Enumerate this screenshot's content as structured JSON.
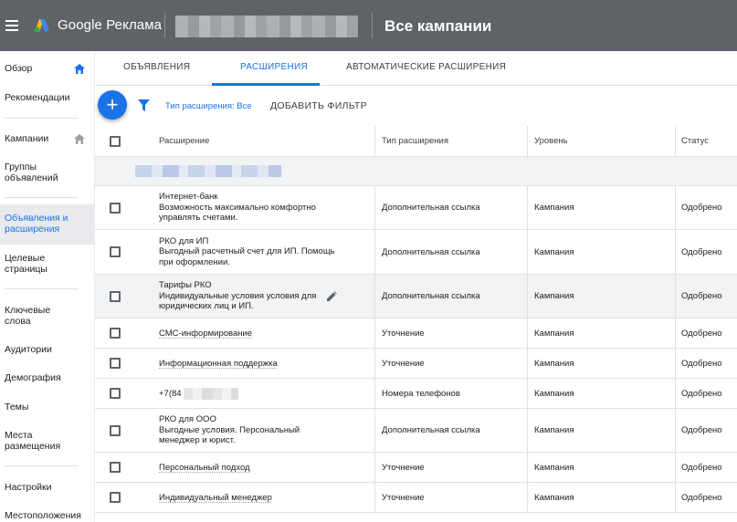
{
  "header": {
    "brand": "Google Реклама",
    "title": "Все кампании"
  },
  "sidebar": {
    "items": [
      {
        "label": "Обзор"
      },
      {
        "label": "Рекомендации"
      },
      {
        "label": "Кампании"
      },
      {
        "label": "Группы объявлений"
      },
      {
        "label": "Объявления и расширения"
      },
      {
        "label": "Целевые страницы"
      },
      {
        "label": "Ключевые слова"
      },
      {
        "label": "Аудитории"
      },
      {
        "label": "Демография"
      },
      {
        "label": "Темы"
      },
      {
        "label": "Места размещения"
      },
      {
        "label": "Настройки"
      },
      {
        "label": "Местоположения"
      }
    ]
  },
  "tabs": [
    {
      "label": "ОБЪЯВЛЕНИЯ"
    },
    {
      "label": "РАСШИРЕНИЯ"
    },
    {
      "label": "АВТОМАТИЧЕСКИЕ РАСШИРЕНИЯ"
    }
  ],
  "toolbar": {
    "fab": "+",
    "filter_label": "Тип расширения: Все",
    "add_filter": "ДОБАВИТЬ ФИЛЬТР"
  },
  "table": {
    "columns": [
      "Расширение",
      "Тип расширения",
      "Уровень",
      "Статус"
    ],
    "rows": [
      {
        "title": "Интернет-банк",
        "desc": "Возможность максимально комфортно управлять счетами.",
        "type": "Дополнительная ссылка",
        "level": "Кампания",
        "status": "Одобрено"
      },
      {
        "title": "РКО для ИП",
        "desc": "Выгодный расчетный счет для ИП. Помощь при оформлении.",
        "type": "Дополнительная ссылка",
        "level": "Кампания",
        "status": "Одобрено"
      },
      {
        "title": "Тарифы РКО",
        "desc": "Индивидуальные условия условия для юридических лиц и ИП.",
        "type": "Дополнительная ссылка",
        "level": "Кампания",
        "status": "Одобрено"
      },
      {
        "title": "СМС-информирование",
        "desc": "",
        "type": "Уточнение",
        "level": "Кампания",
        "status": "Одобрено"
      },
      {
        "title": "Информационная поддержка",
        "desc": "",
        "type": "Уточнение",
        "level": "Кампания",
        "status": "Одобрено"
      },
      {
        "title": "+7(84",
        "desc": "",
        "type": "Номера телефонов",
        "level": "Кампания",
        "status": "Одобрено"
      },
      {
        "title": "РКО для ООО",
        "desc": "Выгодные условия. Персональный менеджер и юрист.",
        "type": "Дополнительная ссылка",
        "level": "Кампания",
        "status": "Одобрено"
      },
      {
        "title": "Персональный подход",
        "desc": "",
        "type": "Уточнение",
        "level": "Кампания",
        "status": "Одобрено"
      },
      {
        "title": "Индивидуальный менеджер",
        "desc": "",
        "type": "Уточнение",
        "level": "Кампания",
        "status": "Одобрено"
      }
    ]
  },
  "colors": {
    "topbar": "#5f6368",
    "accent": "#1a73e8",
    "active_nav_bg": "#e8eaed"
  }
}
